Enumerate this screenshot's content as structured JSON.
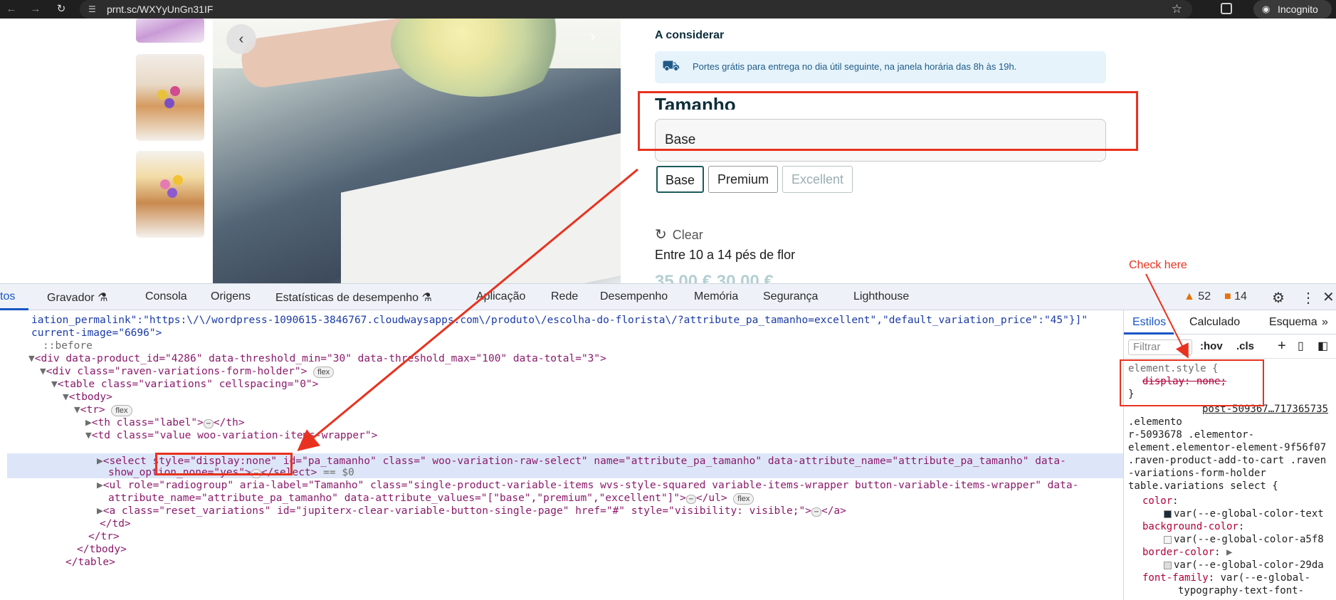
{
  "browser": {
    "url": "prnt.sc/WXYyUnGn31IF",
    "incognito_label": "Incognito"
  },
  "product": {
    "consider_heading": "A considerar",
    "shipping_notice": "Portes grátis para entrega no dia útil seguinte, na janela horária das 8h às 19h.",
    "size_heading": "Tamanho",
    "select_value": "Base",
    "variation_buttons": [
      "Base",
      "Premium",
      "Excellent"
    ],
    "selected_variation": "Base",
    "disabled_variation": "Excellent",
    "clear_label": "Clear",
    "flower_count": "Entre 10 a 14 pés de flor"
  },
  "annotations": {
    "check_here": "Check here",
    "color": "#e8321f"
  },
  "devtools": {
    "tabs": [
      "tos",
      "Gravador",
      "Consola",
      "Origens",
      "Estatísticas de desempenho",
      "Aplicação",
      "Rede",
      "Desempenho",
      "Memória",
      "Segurança",
      "Lighthouse"
    ],
    "warnings_count": "52",
    "issues_count": "14",
    "styles_tabs": [
      "Estilos",
      "Calculado",
      "Esquema"
    ],
    "filter_placeholder": "Filtrar",
    "hov_label": ":hov",
    "cls_label": ".cls",
    "style_rules": {
      "element_style_selector": "element.style {",
      "element_style_decl_prop": "display",
      "element_style_decl_value": " none;",
      "close_brace": "}",
      "source_link": "post-509367…717365735",
      "selector_lines": [
        ".elemento",
        "r-5093678 .elementor-",
        "element.elementor-element-9f56f07",
        ".raven-product-add-to-cart .raven",
        "-variations-form-holder",
        "table.variations select {"
      ],
      "declarations": [
        {
          "prop": "color",
          "value": "var(--e-global-color-text",
          "swatch": "#1b2b3a"
        },
        {
          "prop": "background-color",
          "value": "var(--e-global-color-a5f8",
          "swatch": "#f5f5f5"
        },
        {
          "prop": "border-color",
          "value": "var(--e-global-color-29da",
          "swatch": "#dddddd"
        },
        {
          "prop": "font-family",
          "value": "var(--e-global-",
          "swatch": ""
        }
      ],
      "font_family_cont": "typography-text-font-"
    },
    "dom_lines": {
      "l0": "iation_permalink\":\"https:\\/\\/wordpress-1090615-3846767.cloudwaysapps.com\\/produto\\/escolha-do-florista\\/?attribute_pa_tamanho=excellent\",\"default_variation_price\":\"45\"}]\"",
      "l1": "current-image=\"6696\">",
      "l2": "::before",
      "l3": "<div data-product_id=\"4286\" data-threshold_min=\"30\" data-threshold_max=\"100\" data-total=\"3\">",
      "l4": "<div class=\"raven-variations-form-holder\">",
      "l5": "<table class=\"variations\" cellspacing=\"0\">",
      "l6": "<tbody>",
      "l7": "<tr>",
      "l8": "<th class=\"label\">",
      "l8b": "</th>",
      "l9": "<td class=\"value woo-variation-items-wrapper\">",
      "l10": "<select style=\"display:none\" id=\"pa_tamanho\" class=\" woo-variation-raw-select\" name=\"attribute_pa_tamanho\" data-attribute_name=\"attribute_pa_tamanho\" data-",
      "l11": "show_option_none=\"yes\">",
      "l11b": "</select>",
      "l11c": "== $0",
      "l12": "<ul role=\"radiogroup\" aria-label=\"Tamanho\" class=\"single-product-variable-items wvs-style-squared variable-items-wrapper button-variable-items-wrapper\" data-",
      "l13": "attribute_name=\"attribute_pa_tamanho\" data-attribute_values=\"[\"base\",\"premium\",\"excellent\"]\">",
      "l13b": "</ul>",
      "l14": "<a class=\"reset_variations\" id=\"jupiterx-clear-variable-button-single-page\" href=\"#\" style=\"visibility: visible;\">",
      "l14b": "</a>",
      "l15": "</td>",
      "l16": "</tr>",
      "l17": "</tbody>",
      "l18": "</table>",
      "flex_pill": "flex"
    }
  }
}
